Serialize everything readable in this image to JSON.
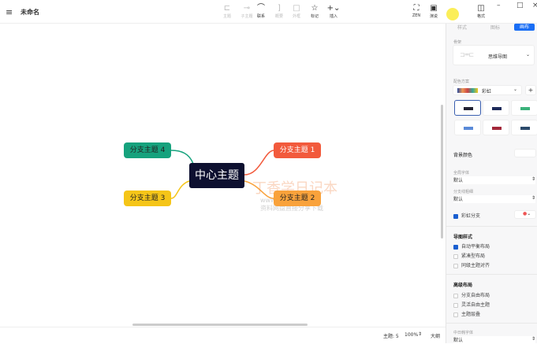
{
  "header": {
    "title": "未命名",
    "toolbar": [
      {
        "icon": "topic-icon",
        "label": "主题"
      },
      {
        "icon": "subtopic-icon",
        "label": "子主题"
      },
      {
        "icon": "relationship-icon",
        "label": "联系"
      },
      {
        "icon": "summary-icon",
        "label": "概要"
      },
      {
        "icon": "boundary-icon",
        "label": "外框"
      },
      {
        "icon": "star-icon",
        "label": "标记"
      },
      {
        "icon": "plus-icon",
        "label": "插入"
      }
    ],
    "zen": "ZEN",
    "pitch": "演说",
    "format": "格式"
  },
  "map": {
    "center": "中心主题",
    "branches": [
      "分支主题 1",
      "分支主题 2",
      "分支主题 3",
      "分支主题 4"
    ],
    "colors": {
      "b1": "#f25a3c",
      "b2": "#f9a23b",
      "b3": "#f5c518",
      "b4": "#16a27d"
    },
    "watermark": [
      "丁香学日记本",
      "www.ts006.net",
      "资料网盘直接分享下载"
    ]
  },
  "status": {
    "topics": "主题: 5",
    "zoom": "100%",
    "outline": "大纲"
  },
  "panel": {
    "tabs": [
      "样式",
      "图标",
      "画布"
    ],
    "structure_label": "骨架",
    "structure": "思维导图",
    "color_scheme_label": "配色方案",
    "color_scheme": "彩虹",
    "bg_label": "背景颜色",
    "font_label": "全局字体",
    "font": "默认",
    "branch_line_label": "分支线粗细",
    "branch_line": "默认",
    "rainbow": "彩虹分支",
    "map_style": "导图样式",
    "map_opts": [
      "自动平衡布局",
      "紧凑型布局",
      "同级主题对齐"
    ],
    "adv": "高级布局",
    "adv_opts": [
      "分支自由布局",
      "灵活自由主题",
      "主题层叠"
    ],
    "cjk_label": "中日韩字体",
    "cjk": "默认"
  }
}
